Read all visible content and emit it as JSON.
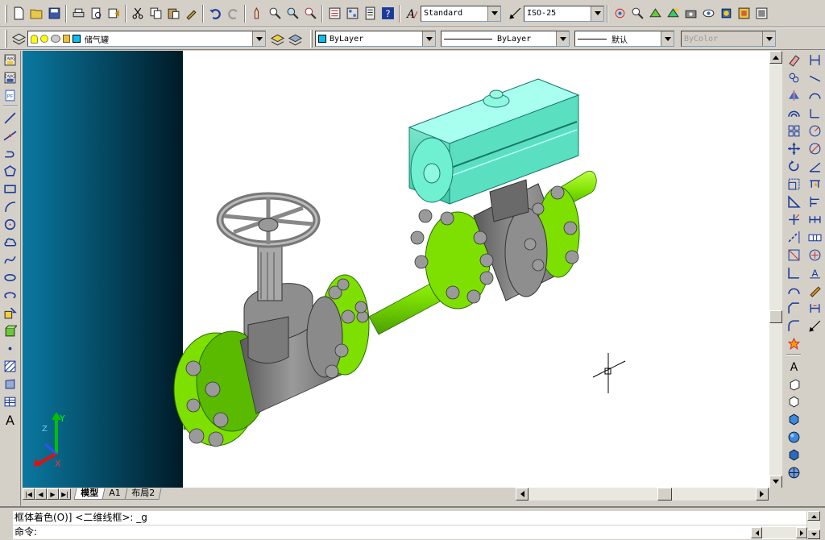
{
  "toolbar_top": {
    "text_style": "Standard",
    "dim_style": "ISO-25"
  },
  "toolbar_layers": {
    "layer_name": "储气罐",
    "color": "ByLayer",
    "linetype": "ByLayer",
    "lineweight": "默认",
    "plot_style": "ByColor"
  },
  "layout_tabs": [
    {
      "label": "模型",
      "active": true
    },
    {
      "label": "A1",
      "active": false
    },
    {
      "label": "布局2",
      "active": false
    }
  ],
  "command": {
    "history_line": "框体着色(O)] <二维线框>: _g",
    "prompt": "命令:"
  },
  "ucs": {
    "x_label": "X",
    "y_label": "Y",
    "z_label": "Z"
  },
  "colors": {
    "pipe_green": "#7ee000",
    "actuator_cyan": "#6ff0d0",
    "body_gray": "#8a8a8a",
    "viewport_teal": "#0a6c8c"
  },
  "icons": {
    "top": [
      "new-icon",
      "open-icon",
      "save-icon",
      "print-icon",
      "print-preview-icon",
      "publish-icon",
      "cut-icon",
      "copy-icon",
      "paste-icon",
      "match-properties-icon",
      "undo-icon",
      "redo-icon",
      "pan-icon",
      "zoom-realtime-icon",
      "zoom-window-icon",
      "zoom-previous-icon",
      "properties-icon",
      "design-center-icon",
      "tool-palette-icon",
      "help-icon"
    ],
    "left": [
      "line-icon",
      "construction-line-icon",
      "polyline-icon",
      "polygon-icon",
      "rectangle-icon",
      "arc-icon",
      "circle-icon",
      "revision-cloud-icon",
      "spline-icon",
      "ellipse-icon",
      "ellipse-arc-icon",
      "insert-block-icon",
      "make-block-icon",
      "point-icon",
      "hatch-icon",
      "region-icon",
      "table-icon",
      "multiline-text-icon"
    ]
  }
}
